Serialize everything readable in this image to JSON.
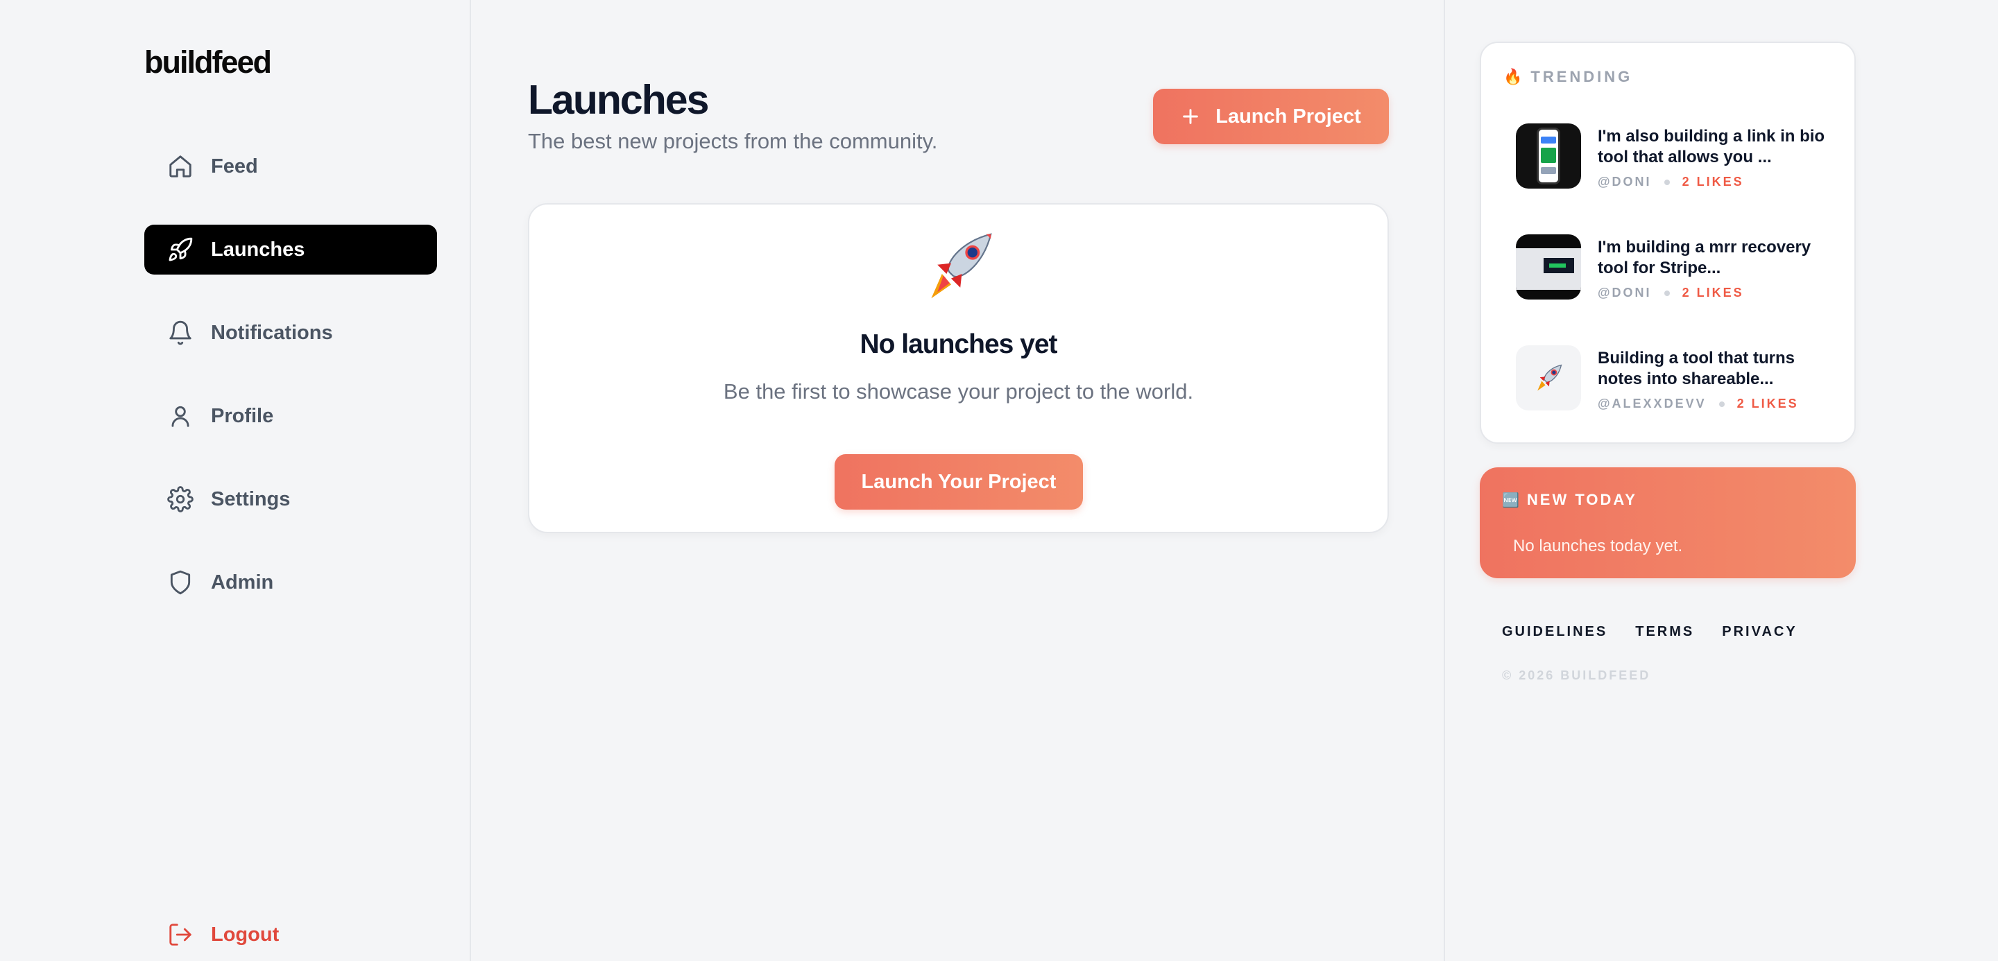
{
  "app": {
    "name": "buildfeed"
  },
  "sidebar": {
    "items": [
      {
        "label": "Feed",
        "icon": "home-icon"
      },
      {
        "label": "Launches",
        "icon": "rocket-icon",
        "active": true
      },
      {
        "label": "Notifications",
        "icon": "bell-icon"
      },
      {
        "label": "Profile",
        "icon": "user-icon"
      },
      {
        "label": "Settings",
        "icon": "gear-icon"
      },
      {
        "label": "Admin",
        "icon": "shield-icon"
      }
    ],
    "logout": {
      "label": "Logout",
      "icon": "logout-icon"
    }
  },
  "main": {
    "title": "Launches",
    "subtitle": "The best new projects from the community.",
    "launch_button": "Launch Project",
    "empty_state": {
      "emoji": "🚀",
      "title": "No launches yet",
      "text": "Be the first to showcase your project to the world.",
      "button": "Launch Your Project"
    }
  },
  "trending": {
    "label": "TRENDING",
    "emoji": "🔥",
    "items": [
      {
        "title": "I'm also building a link in bio tool that allows you ...",
        "author": "@DONI",
        "likes": "2 LIKES",
        "thumb": "phone-screenshot"
      },
      {
        "title": "I'm building a mrr recovery tool for Stripe...",
        "author": "@DONI",
        "likes": "2 LIKES",
        "thumb": "dashboard-screenshot"
      },
      {
        "title": "Building a tool that turns notes into shareable...",
        "author": "@ALEXXDEVV",
        "likes": "2 LIKES",
        "thumb": "rocket-emoji",
        "emoji": "🚀"
      }
    ]
  },
  "new_today": {
    "label": "NEW TODAY",
    "emoji": "🆕",
    "text": "No launches today yet."
  },
  "footer": {
    "links": [
      "GUIDELINES",
      "TERMS",
      "PRIVACY"
    ],
    "copyright": "© 2026 BUILDFEED"
  },
  "colors": {
    "accent_start": "#ef7360",
    "accent_end": "#f38c6a",
    "active_nav_bg": "#000000",
    "logout": "#e0483c",
    "likes": "#ef5a45"
  }
}
